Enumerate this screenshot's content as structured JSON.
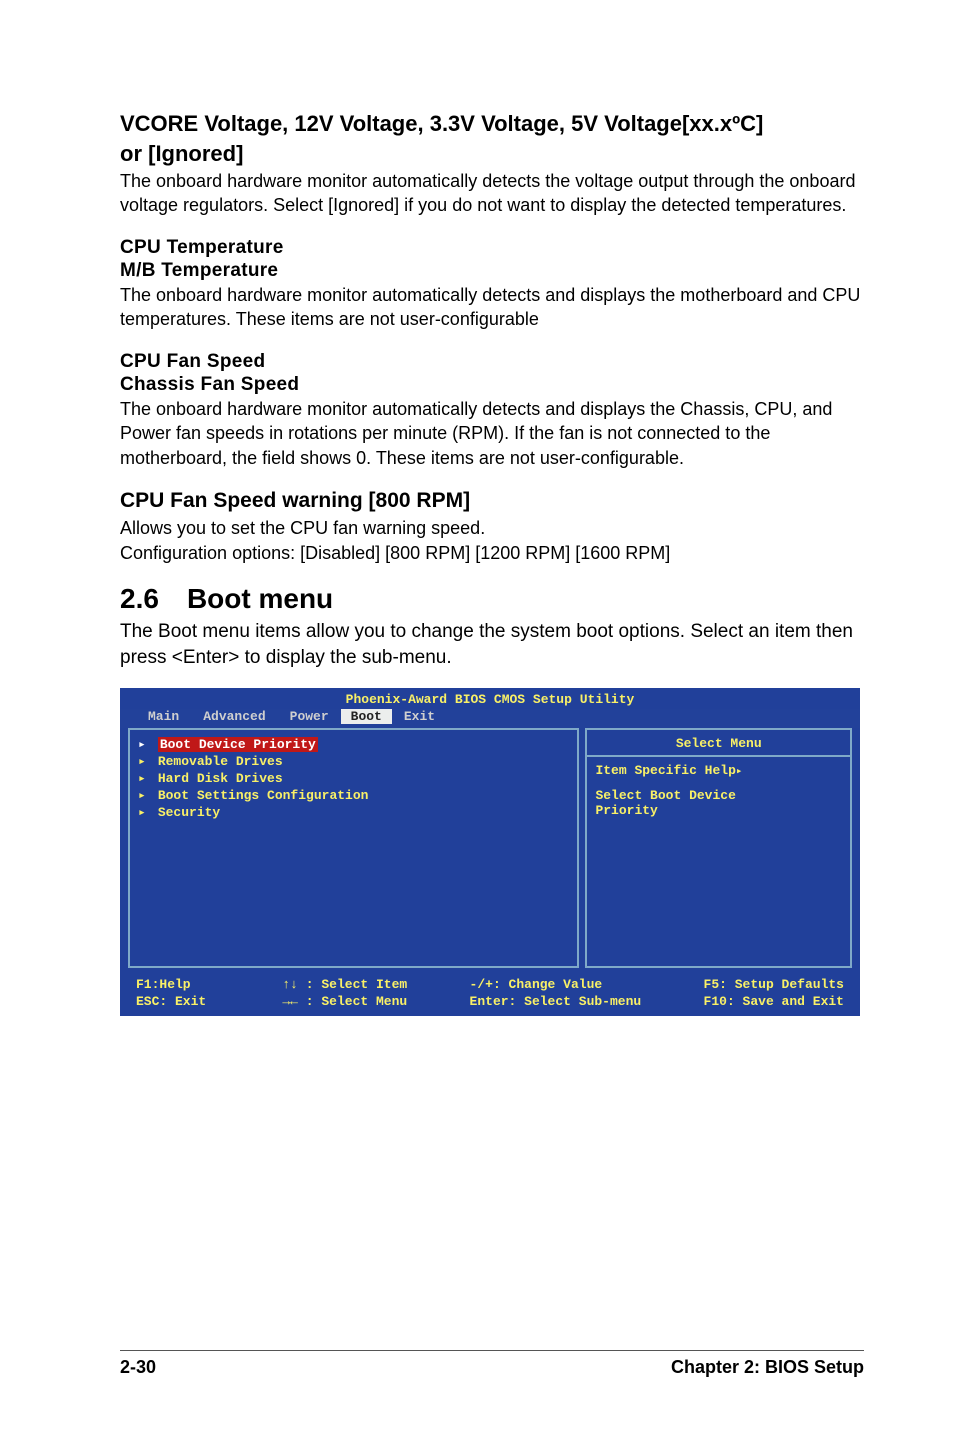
{
  "sec1": {
    "title_line1": "VCORE Voltage, 12V Voltage, 3.3V Voltage, 5V Voltage[xx.xºC]",
    "title_line2": "or [Ignored]",
    "body": "The onboard hardware monitor automatically detects the voltage output through the onboard voltage regulators. Select [Ignored] if you do not want to display the detected temperatures."
  },
  "sec2": {
    "line1": "CPU Temperature",
    "line2": "M/B Temperature",
    "body": "The onboard hardware monitor automatically detects and displays the motherboard and CPU temperatures. These items are not user-configurable"
  },
  "sec3": {
    "line1": "CPU Fan Speed",
    "line2": "Chassis Fan Speed",
    "body": "The onboard hardware monitor automatically detects and displays the Chassis, CPU, and Power fan speeds in rotations per minute (RPM). If the fan is not connected to the motherboard, the field shows 0. These items are not user-configurable."
  },
  "sec4": {
    "title": "CPU Fan Speed warning [800 RPM]",
    "body1": "Allows you to set the CPU fan warning speed.",
    "body2": "Configuration options: [Disabled] [800 RPM] [1200 RPM] [1600 RPM]"
  },
  "h2": {
    "num": "2.6",
    "title": "Boot menu"
  },
  "h2_body": "The Boot menu items allow you to change the system boot options. Select an item then press <Enter> to display the sub-menu.",
  "bios": {
    "title": "Phoenix-Award BIOS CMOS Setup Utility",
    "tabs": [
      "Main",
      "Advanced",
      "Power",
      "Boot",
      "Exit"
    ],
    "active_tab_index": 3,
    "left_items": [
      {
        "label": "Boot Device Priority",
        "selected": true
      },
      {
        "label": "Removable Drives"
      },
      {
        "label": "Hard Disk Drives"
      },
      {
        "label": "Boot Settings Configuration"
      },
      {
        "label": "Security"
      }
    ],
    "right": {
      "title": "Select Menu",
      "help_label": "Item Specific Help",
      "line1": "Select Boot Device",
      "line2": "Priority"
    },
    "footer": {
      "c1r1_k": "F1:Help",
      "c1r2_k": "ESC: Exit",
      "c2r1": "↑↓ : Select Item",
      "c2r2": "→← : Select Menu",
      "c3r1": "-/+: Change Value",
      "c3r2": "Enter: Select Sub-menu",
      "c4r1": "F5: Setup Defaults",
      "c4r2": "F10: Save and Exit"
    }
  },
  "page_footer": {
    "left": "2-30",
    "right": "Chapter 2: BIOS Setup"
  }
}
